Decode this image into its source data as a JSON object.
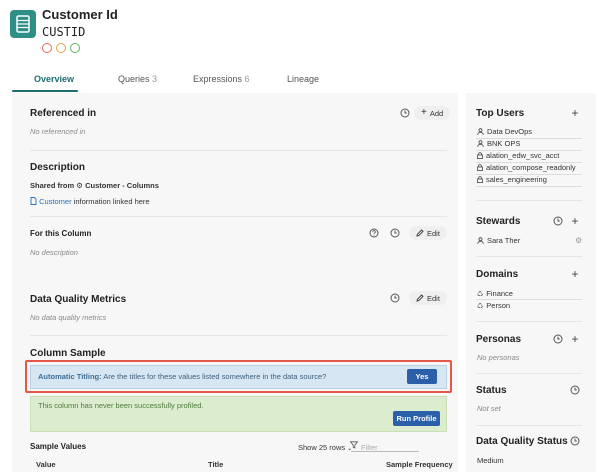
{
  "header": {
    "title": "Customer Id",
    "subtitle": "CUSTID",
    "icon": "table-icon",
    "icon_color": "#2f8f86",
    "trust_flags": [
      {
        "name": "endorse-flag",
        "color": "#e06b5b"
      },
      {
        "name": "warning-flag",
        "color": "#e6a641"
      },
      {
        "name": "deprecate-flag",
        "color": "#5fb25a"
      }
    ]
  },
  "tabs": [
    {
      "label": "Overview",
      "count": ""
    },
    {
      "label": "Queries",
      "count": "3"
    },
    {
      "label": "Expressions",
      "count": "6"
    },
    {
      "label": "Lineage",
      "count": ""
    }
  ],
  "referenced": {
    "title": "Referenced in",
    "add_label": "Add",
    "empty": "No referenced in"
  },
  "description": {
    "title": "Description",
    "shared_prefix": "Shared from",
    "shared_source": "Customer - Columns",
    "link_text": "Customer",
    "link_rest": "information linked here"
  },
  "for_column": {
    "title": "For this Column",
    "edit_label": "Edit",
    "empty": "No description"
  },
  "dq_metrics": {
    "title": "Data Quality Metrics",
    "edit_label": "Edit",
    "empty": "No data quality metrics"
  },
  "column_sample": {
    "title": "Column Sample",
    "auto_title_label": "Automatic Titling:",
    "auto_title_question": "Are the titles for these values listed somewhere in the data source?",
    "yes_label": "Yes",
    "profile_message": "This column has never been successfully profiled.",
    "run_profile_label": "Run Profile",
    "sample_values_label": "Sample Values",
    "show_rows_label": "Show 25 rows",
    "filter_placeholder": "Filter",
    "columns": [
      "Value",
      "Title",
      "Sample Frequency"
    ]
  },
  "sidebar": {
    "top_users": {
      "title": "Top Users",
      "items": [
        "Data DevOps",
        "BNK OPS",
        "alation_edw_svc_acct",
        "alation_compose_readonly",
        "sales_engineering"
      ]
    },
    "stewards": {
      "title": "Stewards",
      "items": [
        "Sara Ther"
      ]
    },
    "domains": {
      "title": "Domains",
      "items": [
        "Finance",
        "Person"
      ]
    },
    "personas": {
      "title": "Personas",
      "empty": "No personas"
    },
    "status": {
      "title": "Status",
      "empty": "Not set"
    },
    "dq_status": {
      "title": "Data Quality Status",
      "value": "Medium"
    }
  },
  "colors": {
    "accent": "#1d6d74",
    "primary_button": "#2b5faa",
    "highlight_outline": "#e6574b"
  }
}
